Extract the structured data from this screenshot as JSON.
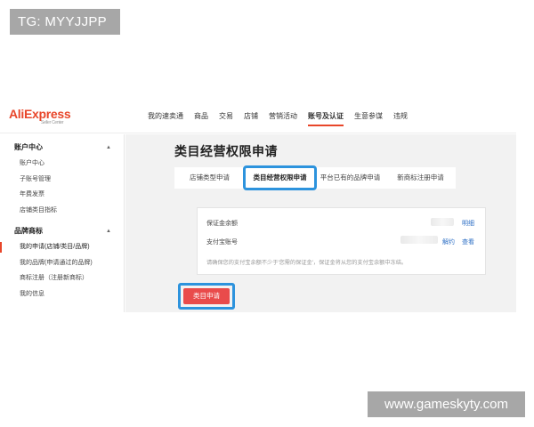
{
  "watermarks": {
    "top": "TG: MYYJJPP",
    "bottom": "www.gameskyty.com"
  },
  "logo": {
    "brand": "AliExpress",
    "subtitle": "Seller Center"
  },
  "nav": [
    "我的速卖通",
    "商品",
    "交易",
    "店铺",
    "营销活动",
    "账号及认证",
    "生意参谋",
    "违规"
  ],
  "nav_active_index": 5,
  "sidebar": {
    "groups": [
      {
        "title": "账户中心",
        "caret": "▲",
        "items": [
          "账户中心",
          "子账号管理",
          "年费发票",
          "店铺类目指标"
        ]
      },
      {
        "title": "品牌商标",
        "caret": "▲",
        "items": [
          "我的申请(店铺/类目/品牌)",
          "我的品牌(申请通过的品牌)",
          "商标注册（注册新商标）",
          "我的信息"
        ]
      }
    ]
  },
  "page_title": "类目经营权限申请",
  "tabs": [
    "店铺类型申请",
    "类目经营权限申请",
    "平台已有的品牌申请",
    "新商标注册申请"
  ],
  "active_tab_index": 1,
  "panel": {
    "deposit_label": "保证金余额",
    "deposit_link": "明细",
    "alipay_label": "支付宝账号",
    "unbind_link": "解约",
    "view_link": "查看",
    "hint": "请确保您的支付宝余额不少于'您需的保证金'，保证金将从您的支付宝余额中冻结。"
  },
  "apply_button": "类目申请",
  "colors": {
    "accent": "#e8462a",
    "highlight": "#2d93dd",
    "button": "#e94b4b",
    "link": "#2d6fc5"
  }
}
